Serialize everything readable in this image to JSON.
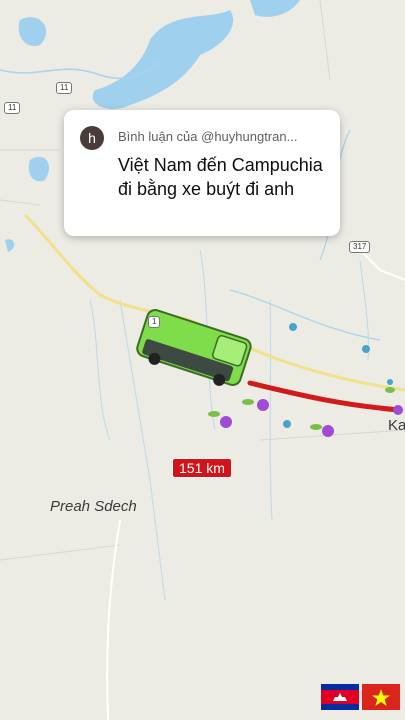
{
  "comment": {
    "avatar_letter": "h",
    "header": "Bình luận của @huyhungtran...",
    "text": "Việt Nam đến Campuchia đi bằng xe buýt đi anh"
  },
  "map": {
    "distance_label": "151 km",
    "place_label": "Preah Sdech",
    "partial_label": "Ka",
    "road_shields": [
      "317",
      "1",
      "11",
      "11"
    ]
  },
  "flags": [
    "cambodia-flag",
    "vietnam-flag"
  ],
  "colors": {
    "route": "#d21a1a",
    "bus": "#7fdc4a",
    "water": "#9fd0ee",
    "land": "#ecebe4"
  }
}
